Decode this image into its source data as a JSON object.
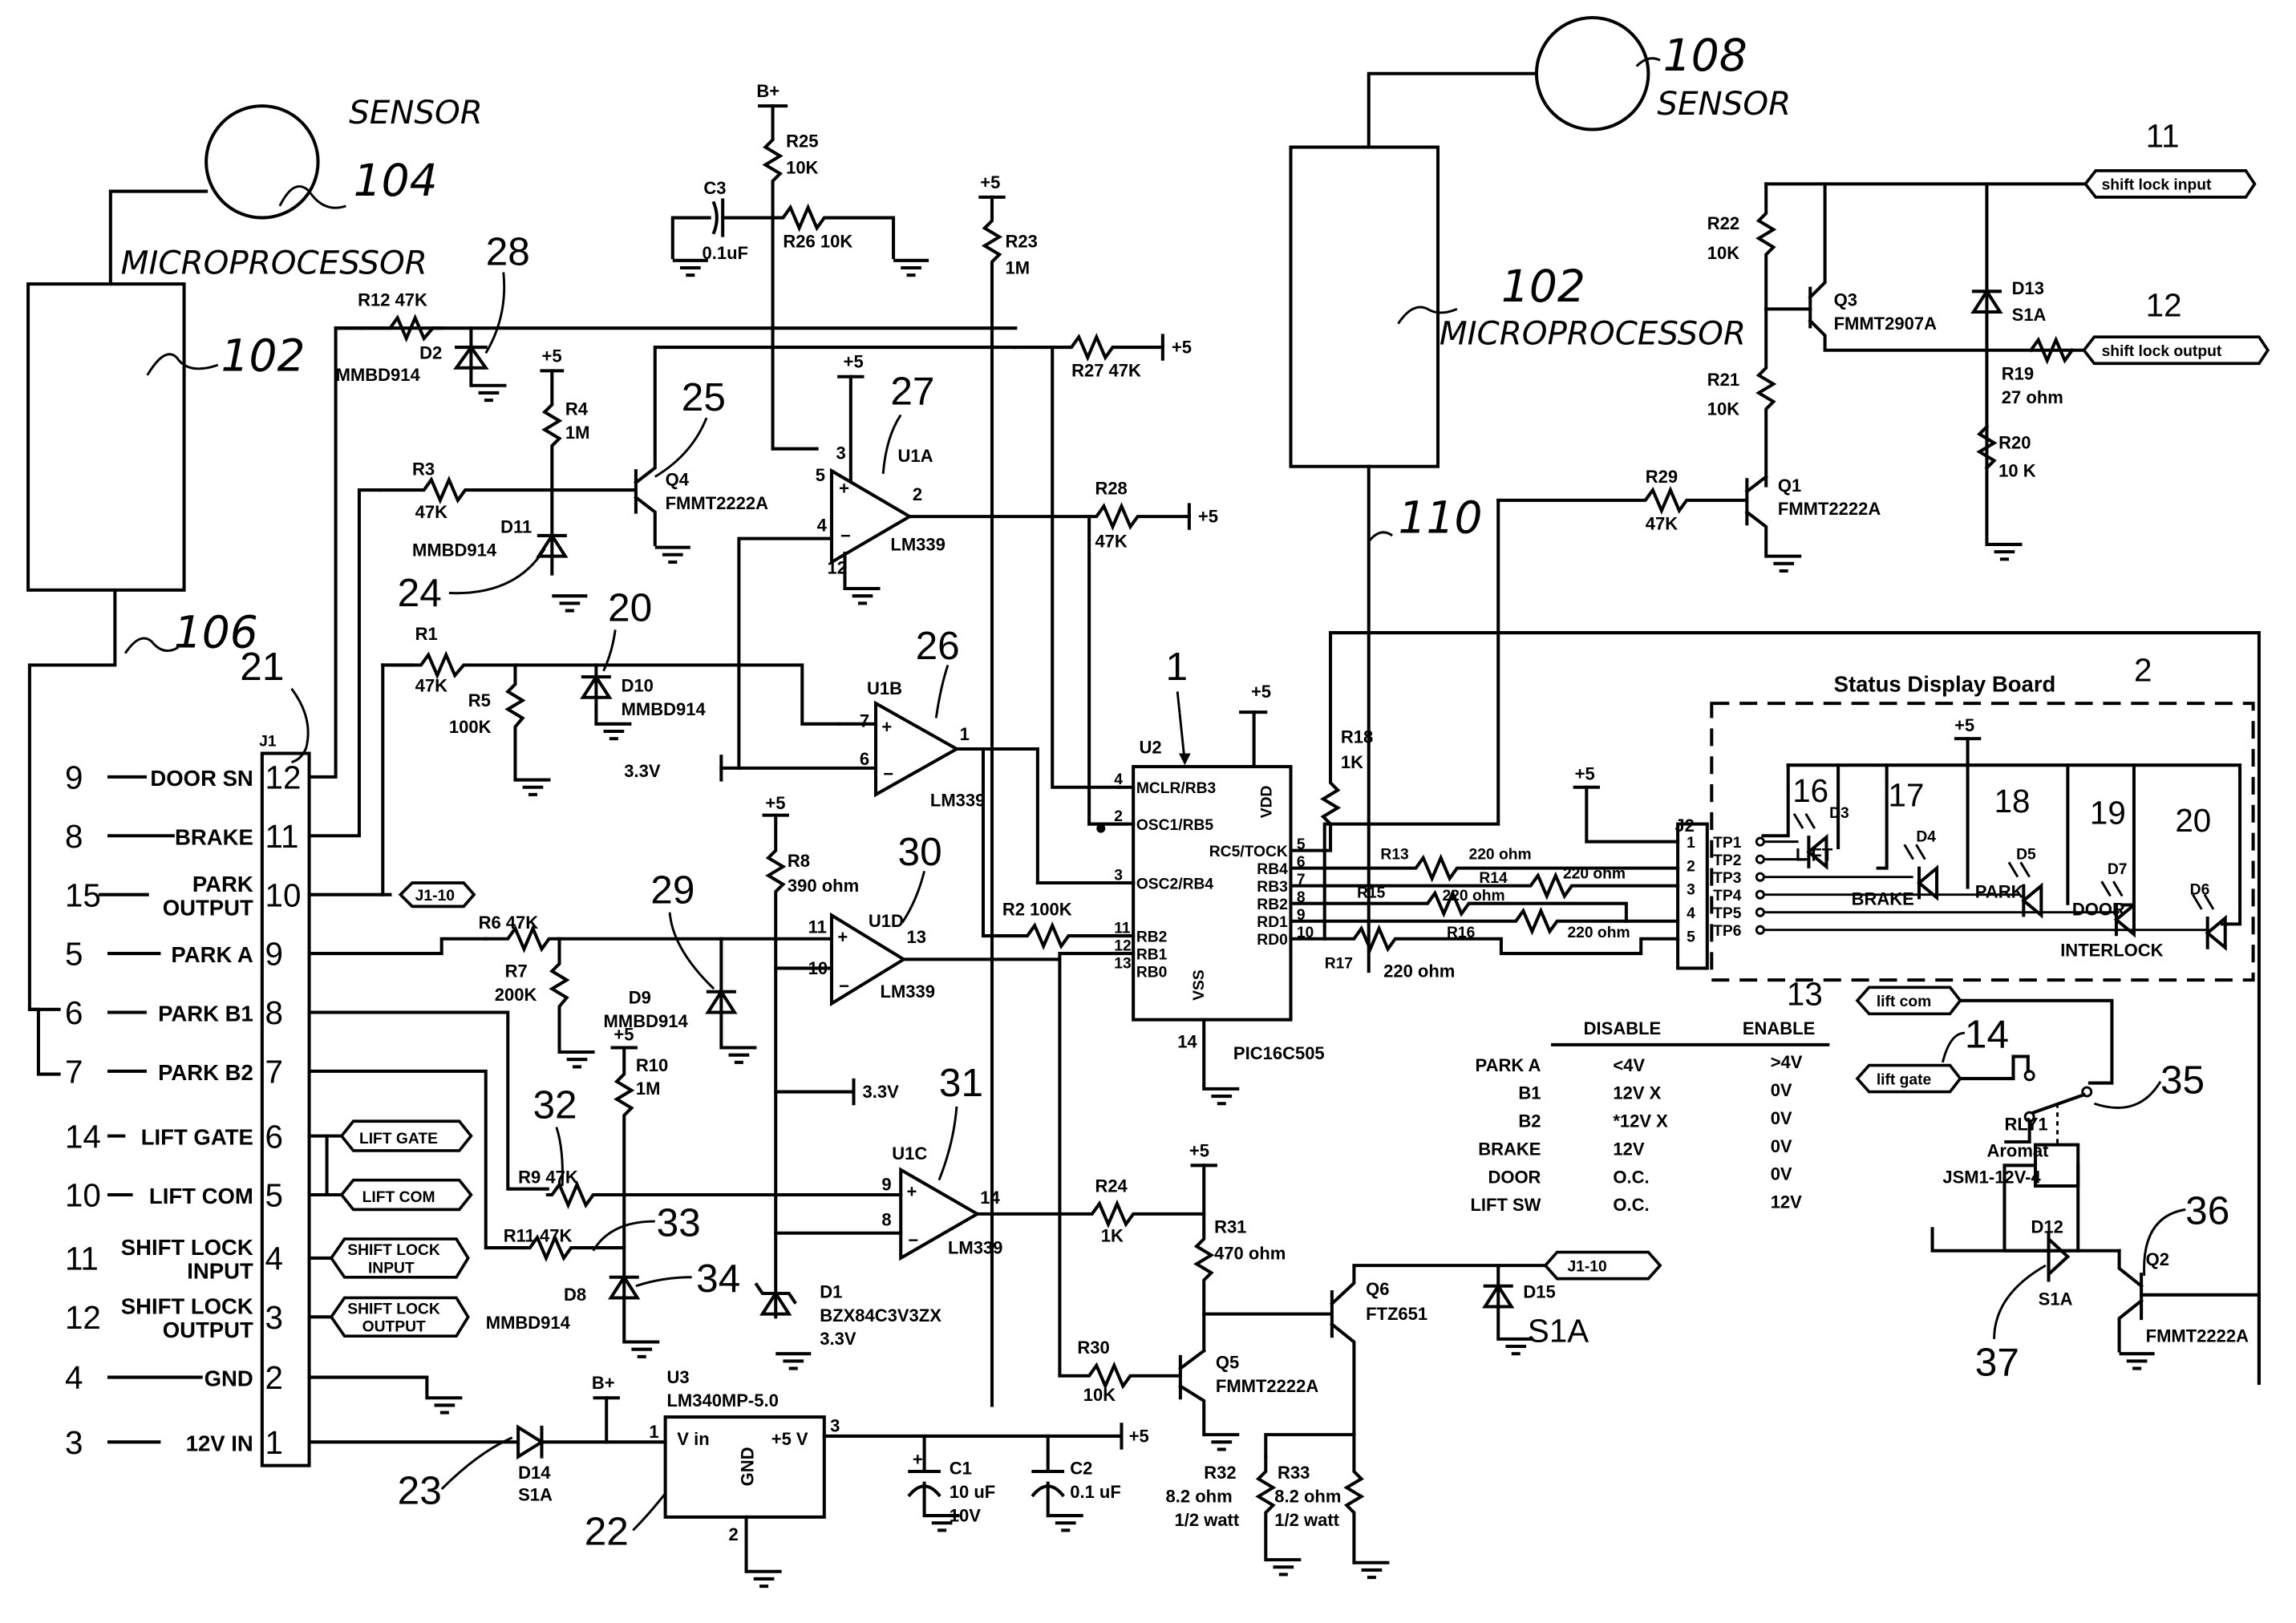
{
  "figure": {
    "type": "circuit-schematic",
    "left_block": {
      "sensor_label": "SENSOR",
      "sensor_ref": "104",
      "micro_label": "MICROPROCESSOR",
      "micro_ref": "102",
      "line_ref": "106"
    },
    "right_block": {
      "sensor_label": "SENSOR",
      "sensor_ref": "108",
      "micro_label": "MICROPROCESSOR",
      "micro_ref": "102",
      "line_ref": "110"
    },
    "connector_j1": {
      "ref": "J1",
      "callout": "21",
      "pins": [
        {
          "wire": "9",
          "label": "DOOR SN",
          "pin": "12"
        },
        {
          "wire": "8",
          "label": "BRAKE",
          "pin": "11"
        },
        {
          "wire": "15",
          "label": "PARK\nOUTPUT",
          "label_1": "PARK",
          "label_2": "OUTPUT",
          "pin": "10"
        },
        {
          "wire": "5",
          "label": "PARK A",
          "pin": "9"
        },
        {
          "wire": "6",
          "label": "PARK B1",
          "pin": "8"
        },
        {
          "wire": "7",
          "label": "PARK B2",
          "pin": "7"
        },
        {
          "wire": "14",
          "label": "LIFT GATE",
          "pin": "6"
        },
        {
          "wire": "10",
          "label": "LIFT COM",
          "pin": "5"
        },
        {
          "wire": "11",
          "label_1": "SHIFT LOCK",
          "label_2": "INPUT",
          "pin": "4"
        },
        {
          "wire": "12",
          "label_1": "SHIFT LOCK",
          "label_2": "OUTPUT",
          "pin": "3"
        },
        {
          "wire": "4",
          "label": "GND",
          "pin": "2"
        },
        {
          "wire": "3",
          "label": "12V IN",
          "pin": "1"
        }
      ],
      "tags": [
        "J1-10",
        "LIFT GATE",
        "LIFT COM",
        "SHIFT LOCK INPUT",
        "SHIFT LOCK OUTPUT"
      ],
      "tag_lines": {
        "j110": "J1-10",
        "liftgate": "LIFT GATE",
        "liftcom": "LIFT COM",
        "sli_1": "SHIFT LOCK",
        "sli_2": "INPUT",
        "slo_1": "SHIFT LOCK",
        "slo_2": "OUTPUT"
      }
    },
    "components": {
      "r12": "R12 47K",
      "d2": "D2",
      "d2_part": "MMBD914",
      "c28": "28",
      "r4": "R4",
      "r4_val": "1M",
      "p5a": "+5",
      "r3": "R3",
      "r3_val": "47K",
      "q4": "Q4",
      "q4_part": "FMMT2222A",
      "c25": "25",
      "d11": "D11",
      "d11_part": "MMBD914",
      "c24": "24",
      "r1": "R1",
      "r1_val": "47K",
      "r5": "R5",
      "r5_val": "100K",
      "d10": "D10",
      "d10_part": "MMBD914",
      "c20": "20",
      "bplus": "B+",
      "r25": "R25",
      "r25_val": "10K",
      "c3": "C3",
      "c3_val": "0.1uF",
      "r26": "R26 10K",
      "r23": "R23",
      "r23_val": "1M",
      "p5b": "+5",
      "r27": "R27 47K",
      "p5c": "+5",
      "u1a": "U1A",
      "u1a_part": "LM339",
      "c27": "27",
      "u1a_pin3": "3",
      "u1a_pin5": "5",
      "u1a_pin4": "4",
      "u1a_pin2": "2",
      "u1a_pin12": "12",
      "p5d": "+5",
      "r28": "R28",
      "r28_val": "47K",
      "p5e": "+5",
      "u1b": "U1B",
      "u1b_part": "LM339",
      "c26": "26",
      "u1b_pin7": "7",
      "u1b_pin6": "6",
      "u1b_pin1": "1",
      "v33a": "3.3V",
      "r6": "R6 47K",
      "r7": "R7",
      "r7_val": "200K",
      "d9": "D9",
      "d9_part": "MMBD914",
      "c29": "29",
      "r8": "R8",
      "r8_val": "390 ohm",
      "p5f": "+5",
      "u1d": "U1D",
      "u1d_part": "LM339",
      "c30": "30",
      "u1d_pin11": "11",
      "u1d_pin10": "10",
      "u1d_pin13": "13",
      "r2": "R2 100K",
      "v33b": "3.3V",
      "r10": "R10",
      "r10_val": "1M",
      "p5g": "+5",
      "r9": "R9 47K",
      "c32": "32",
      "r11": "R11 47K",
      "c33": "33",
      "d8": "D8",
      "d8_part": "MMBD914",
      "c34": "34",
      "d1": "D1",
      "d1_part": "BZX84C3V3ZX",
      "d1_val": "3.3V",
      "u1c": "U1C",
      "u1c_part": "LM339",
      "c31": "31",
      "u1c_pin9": "9",
      "u1c_pin8": "8",
      "u1c_pin14": "14",
      "r24": "R24",
      "r24_val": "1K",
      "p5h": "+5",
      "r31": "R31",
      "r31_val": "470 ohm",
      "r30": "R30",
      "r30_val": "10K",
      "q5": "Q5",
      "q5_part": "FMMT2222A",
      "q6": "Q6",
      "q6_part": "FTZ651",
      "d15": "D15",
      "d15_part": "S1A",
      "j110b": "J1-10",
      "r32": "R32",
      "r32_val": "8.2 ohm",
      "r32_w": "1/2 watt",
      "r33": "R33",
      "r33_val": "8.2 ohm",
      "r33_w": "1/2 watt",
      "d14": "D14",
      "d14_part": "S1A",
      "c23": "23",
      "bplus2": "B+",
      "u3": "U3",
      "u3_part": "LM340MP-5.0",
      "u3_vin": "V in",
      "u3_vout": "+5 V",
      "u3_gnd": "GND",
      "c22": "22",
      "u3_pin1": "1",
      "u3_pin3": "3",
      "u3_pin2": "2",
      "p5i": "+5",
      "c1": "C1",
      "c1_val": "10 uF",
      "c1_v": "10V",
      "c2": "C2",
      "c2_val": "0.1 uF"
    },
    "pic": {
      "ref": "U2",
      "callout": "1",
      "part": "PIC16C505",
      "vdd": "VDD",
      "vss": "VSS",
      "p5": "+5",
      "left_pins": [
        {
          "num": "4",
          "name": "MCLR/RB3"
        },
        {
          "num": "2",
          "name": "OSC1/RB5"
        },
        {
          "num": "3",
          "name": "OSC2/RB4"
        },
        {
          "num": "11",
          "name": "RB2"
        },
        {
          "num": "12",
          "name": "RB1"
        },
        {
          "num": "13",
          "name": "RB0"
        }
      ],
      "right_pins": [
        {
          "num": "5",
          "name": "RC5/TOCK"
        },
        {
          "num": "6",
          "name": "RB4"
        },
        {
          "num": "7",
          "name": "RB3"
        },
        {
          "num": "8",
          "name": "RB2"
        },
        {
          "num": "9",
          "name": "RD1"
        },
        {
          "num": "10",
          "name": "RD0"
        }
      ],
      "pin14": "14",
      "r18": "R18",
      "r18_val": "1K",
      "r13": "R13",
      "r14": "R14",
      "r15": "R15",
      "r16": "R16",
      "r17": "R17",
      "r_val": "220 ohm"
    },
    "shift_lock": {
      "ref11": "11",
      "in_tag": "shift lock input",
      "ref12": "12",
      "out_tag": "shift lock output",
      "r22": "R22",
      "r22_val": "10K",
      "r21": "R21",
      "r21_val": "10K",
      "q3": "Q3",
      "q3_part": "FMMT2907A",
      "d13": "D13",
      "d13_part": "S1A",
      "r19": "R19",
      "r19_val": "27 ohm",
      "r20": "R20",
      "r20_val": "10 K",
      "r29": "R29",
      "r29_val": "47K",
      "q1": "Q1",
      "q1_part": "FMMT2222A"
    },
    "status_board": {
      "title": "Status Display Board",
      "ref": "2",
      "j2": "J2",
      "p5": "+5",
      "p5b": "+5",
      "j2_pins": [
        "1",
        "2",
        "3",
        "4",
        "5"
      ],
      "tps": [
        "TP1",
        "TP2",
        "TP3",
        "TP4",
        "TP5",
        "TP6"
      ],
      "leds": [
        {
          "callout": "16",
          "ref": "D3",
          "label": "LIFT"
        },
        {
          "callout": "17",
          "ref": "D4",
          "label": "BRAKE"
        },
        {
          "callout": "18",
          "ref": "D5",
          "label": "PARK"
        },
        {
          "callout": "19",
          "ref": "D7",
          "label": "DOOR"
        },
        {
          "callout": "20",
          "ref": "D6",
          "label": "INTERLOCK"
        }
      ]
    },
    "truth_table": {
      "callout": "13",
      "headers": [
        "",
        "DISABLE",
        "ENABLE"
      ],
      "rows": [
        [
          "PARK A",
          "<4V",
          ">4V"
        ],
        [
          "B1",
          "12V X",
          "0V"
        ],
        [
          "B2",
          "*12V X",
          "0V"
        ],
        [
          "BRAKE",
          "12V",
          "0V"
        ],
        [
          "DOOR",
          "O.C.",
          "0V"
        ],
        [
          "LIFT SW",
          "O.C.",
          "12V"
        ]
      ]
    },
    "relay": {
      "liftcom_tag": "lift com",
      "liftgate_tag": "lift gate",
      "c14": "14",
      "c35": "35",
      "c36": "36",
      "c37": "37",
      "ref": "RLY1",
      "brand": "Aromat",
      "part": "JSM1-12V-4",
      "d12": "D12",
      "d12_part": "S1A",
      "q2": "Q2",
      "q2_part": "FMMT2222A"
    }
  }
}
